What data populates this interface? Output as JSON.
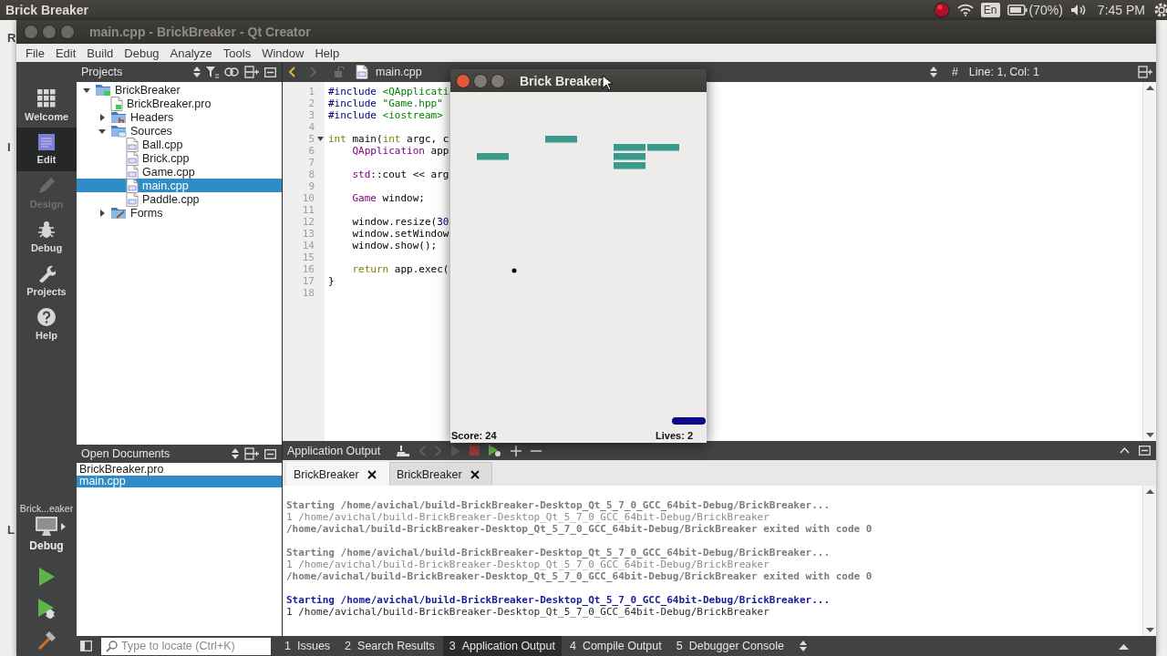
{
  "top_panel": {
    "title": "Brick Breaker",
    "keyboard": "En",
    "battery": "(70%)",
    "clock": "7:45 PM"
  },
  "background_window": {
    "labels": [
      "R",
      "I",
      "L"
    ]
  },
  "window": {
    "title": "main.cpp - BrickBreaker - Qt Creator"
  },
  "menu": [
    "File",
    "Edit",
    "Build",
    "Debug",
    "Analyze",
    "Tools",
    "Window",
    "Help"
  ],
  "modes": [
    {
      "label": "Welcome",
      "kind": "welcome",
      "selected": false,
      "disabled": false
    },
    {
      "label": "Edit",
      "kind": "edit",
      "selected": true,
      "disabled": false
    },
    {
      "label": "Design",
      "kind": "design",
      "selected": false,
      "disabled": true
    },
    {
      "label": "Debug",
      "kind": "debug",
      "selected": false,
      "disabled": false
    },
    {
      "label": "Projects",
      "kind": "projects",
      "selected": false,
      "disabled": false
    },
    {
      "label": "Help",
      "kind": "help",
      "selected": false,
      "disabled": false
    }
  ],
  "kit": {
    "project": "Brick...eaker",
    "build": "Debug"
  },
  "projects_pane": {
    "title": "Projects",
    "tree": [
      {
        "label": "BrickBreaker",
        "kind": "project",
        "expanded": true,
        "selected": false,
        "children": [
          {
            "label": "BrickBreaker.pro",
            "kind": "pro",
            "selected": false
          },
          {
            "label": "Headers",
            "kind": "headers",
            "expanded": false,
            "selected": false
          },
          {
            "label": "Sources",
            "kind": "sources",
            "expanded": true,
            "selected": false,
            "children": [
              {
                "label": "Ball.cpp",
                "kind": "cpp",
                "selected": false
              },
              {
                "label": "Brick.cpp",
                "kind": "cpp",
                "selected": false
              },
              {
                "label": "Game.cpp",
                "kind": "cpp",
                "selected": false
              },
              {
                "label": "main.cpp",
                "kind": "cpp",
                "selected": true
              },
              {
                "label": "Paddle.cpp",
                "kind": "cpp",
                "selected": false
              }
            ]
          },
          {
            "label": "Forms",
            "kind": "forms",
            "expanded": false,
            "selected": false
          }
        ]
      }
    ]
  },
  "open_documents": {
    "title": "Open Documents",
    "items": [
      {
        "label": "BrickBreaker.pro",
        "selected": false
      },
      {
        "label": "main.cpp",
        "selected": true
      }
    ]
  },
  "editor": {
    "file": "main.cpp",
    "hash": "#",
    "position": "Line: 1, Col: 1",
    "lines": [
      {
        "number": "1",
        "foldable": false,
        "tokens": [
          {
            "text": "#include",
            "kind": "pre"
          },
          {
            "text": " <QApplicati",
            "kind": "str"
          }
        ]
      },
      {
        "number": "2",
        "foldable": false,
        "tokens": [
          {
            "text": "#include",
            "kind": "pre"
          },
          {
            "text": " \"Game.hpp\"",
            "kind": "str"
          }
        ]
      },
      {
        "number": "3",
        "foldable": false,
        "tokens": [
          {
            "text": "#include",
            "kind": "pre"
          },
          {
            "text": " <iostream>",
            "kind": "str"
          }
        ]
      },
      {
        "number": "4",
        "foldable": false
      },
      {
        "number": "5",
        "foldable": true,
        "tokens": [
          {
            "text": "int",
            "kind": "kw"
          },
          {
            "text": " main(",
            "kind": "plain"
          },
          {
            "text": "int",
            "kind": "kw"
          },
          {
            "text": " argc, c",
            "kind": "plain"
          }
        ]
      },
      {
        "number": "6",
        "foldable": false,
        "tokens": [
          {
            "text": "    QApplication",
            "kind": "type"
          },
          {
            "text": " app",
            "kind": "plain"
          }
        ]
      },
      {
        "number": "7",
        "foldable": false
      },
      {
        "number": "8",
        "foldable": false,
        "tokens": [
          {
            "text": "    std",
            "kind": "type"
          },
          {
            "text": "::cout << arg",
            "kind": "plain"
          }
        ]
      },
      {
        "number": "9",
        "foldable": false
      },
      {
        "number": "10",
        "foldable": false,
        "tokens": [
          {
            "text": "    Game",
            "kind": "type"
          },
          {
            "text": " window;",
            "kind": "plain"
          }
        ]
      },
      {
        "number": "11",
        "foldable": false
      },
      {
        "number": "12",
        "foldable": false,
        "tokens": [
          {
            "text": "    window.resize(",
            "kind": "plain"
          },
          {
            "text": "30",
            "kind": "num"
          }
        ]
      },
      {
        "number": "13",
        "foldable": false,
        "tokens": [
          {
            "text": "    window.setWindow",
            "kind": "plain"
          }
        ]
      },
      {
        "number": "14",
        "foldable": false,
        "tokens": [
          {
            "text": "    window.show();",
            "kind": "plain"
          }
        ]
      },
      {
        "number": "15",
        "foldable": false
      },
      {
        "number": "16",
        "foldable": false,
        "tokens": [
          {
            "text": "    return",
            "kind": "kw"
          },
          {
            "text": " app.exec(",
            "kind": "plain"
          }
        ]
      },
      {
        "number": "17",
        "foldable": false,
        "tokens": [
          {
            "text": "}",
            "kind": "plain"
          }
        ]
      },
      {
        "number": "18",
        "foldable": false
      }
    ]
  },
  "game_window": {
    "title": "Brick Breaker",
    "score": "Score: 24",
    "lives": "Lives: 2"
  },
  "output_pane": {
    "title": "Application Output",
    "tabs": [
      {
        "label": "BrickBreaker",
        "selected": true
      },
      {
        "label": "BrickBreaker",
        "selected": false
      }
    ],
    "lines": [
      {
        "kind": "start",
        "text": "Starting /home/avichal/build-BrickBreaker-Desktop_Qt_5_7_0_GCC_64bit-Debug/BrickBreaker..."
      },
      {
        "kind": "args",
        "text": "1 /home/avichal/build-BrickBreaker-Desktop_Qt_5_7_0_GCC_64bit-Debug/BrickBreaker"
      },
      {
        "kind": "exit",
        "text": "/home/avichal/build-BrickBreaker-Desktop_Qt_5_7_0_GCC_64bit-Debug/BrickBreaker exited with code 0"
      },
      {
        "kind": "blank"
      },
      {
        "kind": "start",
        "text": "Starting /home/avichal/build-BrickBreaker-Desktop_Qt_5_7_0_GCC_64bit-Debug/BrickBreaker..."
      },
      {
        "kind": "args",
        "text": "1 /home/avichal/build-BrickBreaker-Desktop_Qt_5_7_0_GCC_64bit-Debug/BrickBreaker"
      },
      {
        "kind": "exit",
        "text": "/home/avichal/build-BrickBreaker-Desktop_Qt_5_7_0_GCC_64bit-Debug/BrickBreaker exited with code 0"
      },
      {
        "kind": "blank"
      },
      {
        "kind": "start_current",
        "text": "Starting /home/avichal/build-BrickBreaker-Desktop_Qt_5_7_0_GCC_64bit-Debug/BrickBreaker..."
      },
      {
        "kind": "args_current",
        "text": "1 /home/avichal/build-BrickBreaker-Desktop_Qt_5_7_0_GCC_64bit-Debug/BrickBreaker"
      }
    ]
  },
  "status_bar": {
    "locator_placeholder": "Type to locate (Ctrl+K)",
    "tabs": [
      {
        "number": "1",
        "label": "Issues",
        "selected": false
      },
      {
        "number": "2",
        "label": "Search Results",
        "selected": false
      },
      {
        "number": "3",
        "label": "Application Output",
        "selected": true
      },
      {
        "number": "4",
        "label": "Compile Output",
        "selected": false
      },
      {
        "number": "5",
        "label": "Debugger Console",
        "selected": false
      }
    ]
  }
}
